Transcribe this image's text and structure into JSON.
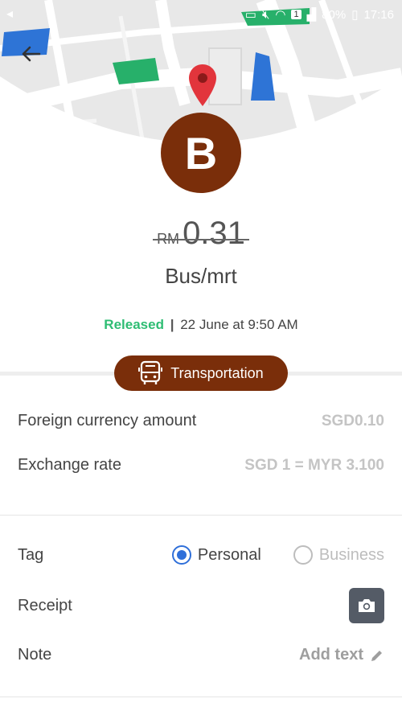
{
  "status_bar": {
    "battery": "80%",
    "time": "17:16",
    "sim": "1"
  },
  "header": {
    "back_icon": "arrow-left-icon"
  },
  "merchant": {
    "initial": "B",
    "name": "Bus/mrt"
  },
  "amount": {
    "currency": "RM",
    "value": "0.31"
  },
  "status": {
    "state": "Released",
    "separator": "|",
    "date": "22 June at 9:50 AM"
  },
  "category": {
    "label": "Transportation",
    "icon": "bus-icon"
  },
  "details": {
    "foreign_label": "Foreign currency amount",
    "foreign_value": "SGD0.10",
    "rate_label": "Exchange rate",
    "rate_value": "SGD 1 = MYR 3.100"
  },
  "tag": {
    "label": "Tag",
    "options": [
      "Personal",
      "Business"
    ],
    "selected": "Personal"
  },
  "receipt": {
    "label": "Receipt",
    "icon": "camera-icon"
  },
  "note": {
    "label": "Note",
    "action": "Add text",
    "icon": "pencil-icon"
  },
  "colors": {
    "brand": "#7a2e0a",
    "released": "#2ebd73",
    "radio": "#2f6fd9"
  }
}
